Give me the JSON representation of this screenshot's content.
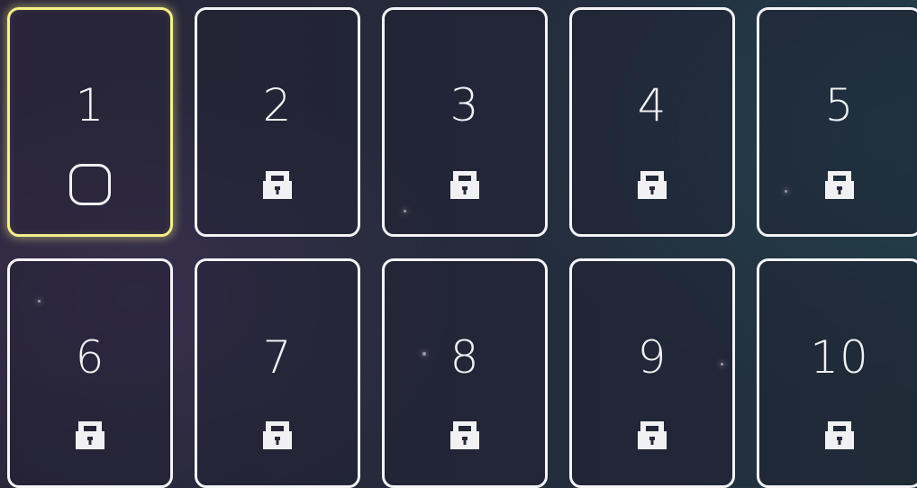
{
  "levels": [
    {
      "label": "1",
      "status": "unlocked",
      "icon": "empty-square-icon",
      "selected": true
    },
    {
      "label": "2",
      "status": "locked",
      "icon": "padlock-icon",
      "selected": false
    },
    {
      "label": "3",
      "status": "locked",
      "icon": "padlock-icon",
      "selected": false
    },
    {
      "label": "4",
      "status": "locked",
      "icon": "padlock-icon",
      "selected": false
    },
    {
      "label": "5",
      "status": "locked",
      "icon": "padlock-icon",
      "selected": false
    },
    {
      "label": "6",
      "status": "locked",
      "icon": "padlock-icon",
      "selected": false
    },
    {
      "label": "7",
      "status": "locked",
      "icon": "padlock-icon",
      "selected": false
    },
    {
      "label": "8",
      "status": "locked",
      "icon": "padlock-icon",
      "selected": false
    },
    {
      "label": "9",
      "status": "locked",
      "icon": "padlock-icon",
      "selected": false
    },
    {
      "label": "10",
      "status": "locked",
      "icon": "padlock-icon",
      "selected": false
    }
  ],
  "colors": {
    "card_border": "#f4f4f6",
    "selected_border": "#f7ef8a",
    "text": "#f1f1f3"
  }
}
